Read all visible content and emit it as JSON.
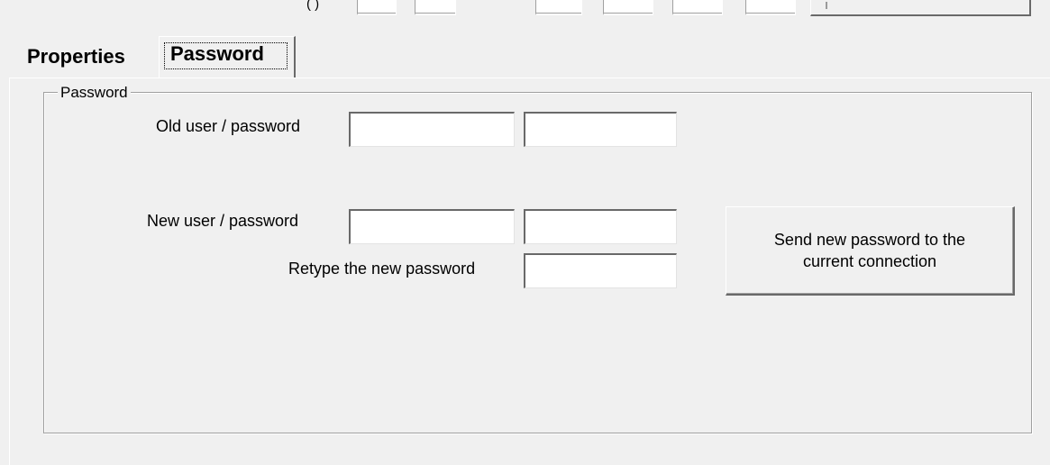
{
  "top_strip": {
    "paren_text": "(    )"
  },
  "tabs": [
    {
      "label": "Properties",
      "selected": false
    },
    {
      "label": "Password",
      "selected": true
    }
  ],
  "password_group": {
    "legend": "Password",
    "old_label": "Old user / password",
    "new_label": "New user / password",
    "retype_label": "Retype the new password",
    "old_user_value": "",
    "old_password_value": "",
    "new_user_value": "",
    "new_password_value": "",
    "retype_password_value": "",
    "send_button_line1": "Send new password to the",
    "send_button_line2": "current connection"
  },
  "colors": {
    "background": "#f0f0f0",
    "field_background": "#ffffff",
    "shadow_dark": "#696969",
    "shadow_mid": "#a0a0a0"
  }
}
